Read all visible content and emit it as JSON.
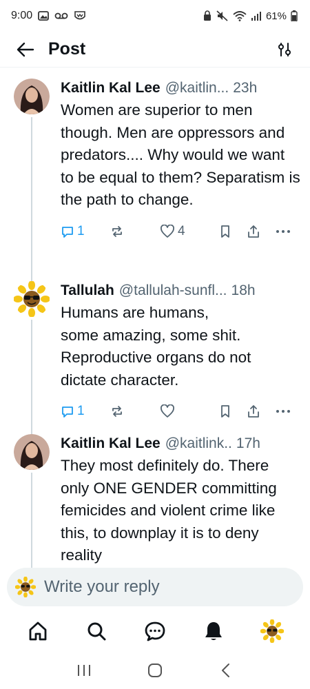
{
  "status_bar": {
    "time": "9:00",
    "battery": "61%",
    "left_icons": [
      "gallery-icon",
      "voicemail-icon",
      "app-icon"
    ],
    "right_icons": [
      "lock-icon",
      "mute-icon",
      "wifi-icon",
      "signal-icon",
      "battery-icon"
    ]
  },
  "header": {
    "title": "Post",
    "back_icon": "arrow-left-icon",
    "filter_icon": "sliders-icon"
  },
  "posts": [
    {
      "author": "Kaitlin Kal Lee",
      "handle": "@kaitlin...",
      "time": "23h",
      "text": "Women are superior to men though. Men are oppressors and predators.... Why would we want to be equal to them? Separatism is the path to change.",
      "replies": "1",
      "reposts": "",
      "likes": "4",
      "avatar": "woman-portrait-avatar"
    },
    {
      "author": "Tallulah",
      "handle": "@tallulah-sunfl...",
      "time": "18h",
      "text": "Humans are humans,\nsome amazing, some shit. Reproductive organs do not dictate character.",
      "replies": "1",
      "reposts": "",
      "likes": "",
      "avatar": "sunflower-avatar"
    },
    {
      "author": "Kaitlin Kal Lee",
      "handle": "@kaitlink..",
      "time": "17h",
      "text": "They most definitely do. There only ONE GENDER committing femicides and violent crime like this, to downplay it is to deny reality",
      "avatar": "woman-portrait-avatar"
    }
  ],
  "reply_bar": {
    "placeholder": "Write your reply"
  },
  "bottom_nav": [
    "home-icon",
    "search-icon",
    "chat-icon",
    "bell-icon",
    "profile-avatar"
  ],
  "system_nav": [
    "recent-apps-icon",
    "home-button-icon",
    "back-icon"
  ],
  "colors": {
    "text": "#0f1419",
    "muted": "#536471",
    "accent": "#1d9bf0",
    "divider": "#cfd9de"
  }
}
